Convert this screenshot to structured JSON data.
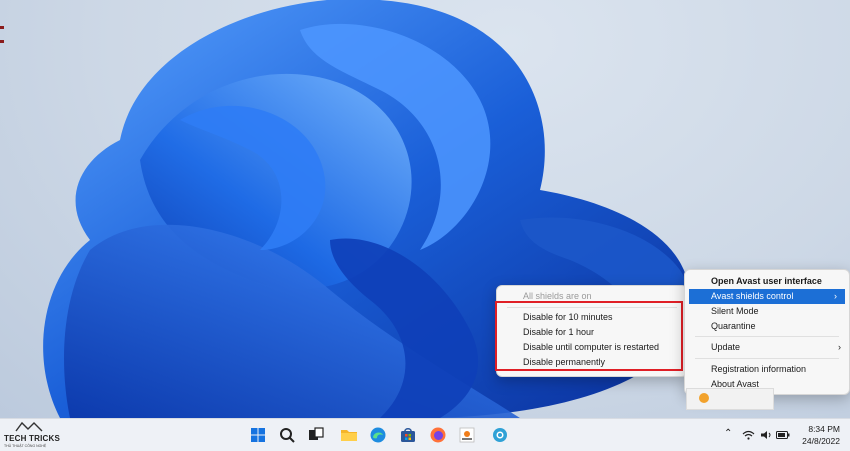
{
  "shield_submenu": {
    "status": "All shields are on",
    "options": [
      "Disable for 10 minutes",
      "Disable for 1 hour",
      "Disable until computer is restarted",
      "Disable permanently"
    ]
  },
  "avast_menu": {
    "open_ui": "Open Avast user interface",
    "shields_control": "Avast shields control",
    "silent_mode": "Silent Mode",
    "quarantine": "Quarantine",
    "update": "Update",
    "registration": "Registration information",
    "about": "About Avast"
  },
  "taskbar": {
    "brand_title": "TECH TRICKS",
    "brand_subtitle": "THỦ THUẬT CÔNG NGHỆ",
    "apps": [
      "start-icon",
      "search-icon",
      "task-view-icon",
      "file-explorer-icon",
      "edge-icon",
      "microsoft-store-icon",
      "firefox-icon",
      "avast-setup-icon",
      "app-icon"
    ]
  },
  "clock": {
    "time": "8:34 PM",
    "date": "24/8/2022"
  },
  "colors": {
    "menu_highlight": "#1c6fd6",
    "annotation_box": "#e01f26",
    "wallpaper_blue": "#1a5fd8"
  }
}
